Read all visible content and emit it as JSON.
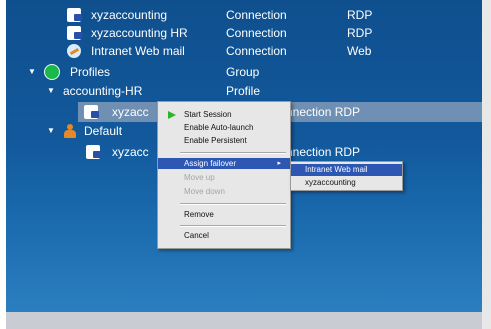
{
  "tree": {
    "rows": [
      {
        "name": "xyzaccounting",
        "type": "Connection",
        "protocol": "RDP"
      },
      {
        "name": "xyzaccounting HR",
        "type": "Connection",
        "protocol": "RDP"
      },
      {
        "name": "Intranet Web mail",
        "type": "Connection",
        "protocol": "Web"
      },
      {
        "name": "Profiles",
        "type": "Group",
        "protocol": ""
      },
      {
        "name": "accounting-HR",
        "type": "Profile",
        "protocol": ""
      },
      {
        "name": "xyzacc",
        "type": "nnection RDP",
        "protocol": ""
      },
      {
        "name": "Default",
        "type": "",
        "protocol": ""
      },
      {
        "name": "xyzacc",
        "type": "nnection RDP",
        "protocol": ""
      }
    ]
  },
  "context_menu": {
    "items": [
      {
        "label": "Start Session",
        "enabled": true
      },
      {
        "label": "Enable Auto-launch",
        "enabled": true
      },
      {
        "label": "Enable Persistent",
        "enabled": true
      },
      {
        "label": "Assign failover",
        "enabled": true,
        "highlighted": true,
        "has_submenu": true
      },
      {
        "label": "Move up",
        "enabled": false
      },
      {
        "label": "Move down",
        "enabled": false
      },
      {
        "label": "Remove",
        "enabled": true
      },
      {
        "label": "Cancel",
        "enabled": true
      }
    ],
    "submenu_arrow": "▸"
  },
  "failover_submenu": {
    "items": [
      {
        "label": "Intranet Web mail",
        "highlighted": true
      },
      {
        "label": "xyzaccounting",
        "highlighted": false
      }
    ]
  },
  "colors": {
    "panel": "#12599c",
    "selection": "#6f8fb3",
    "menu_bg": "#e7e7e7",
    "menu_highlight": "#2d57b3"
  }
}
